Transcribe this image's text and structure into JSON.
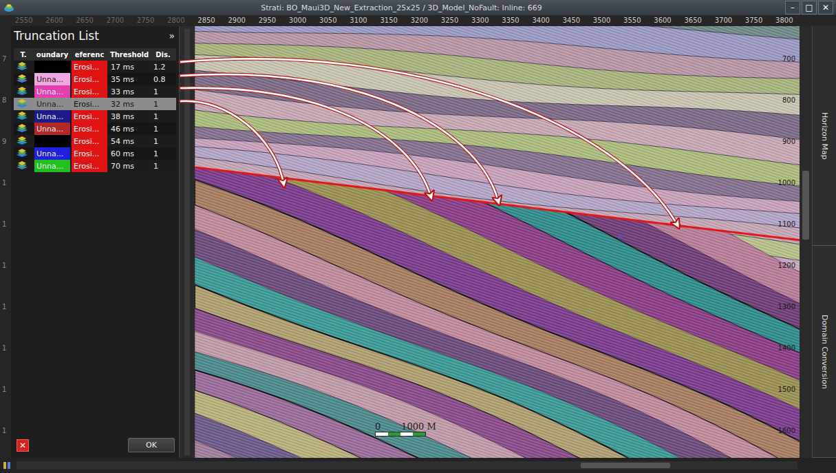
{
  "window": {
    "title": "Strati: BO_Maui3D_New_Extraction_25x25 / 3D_Model_NoFault: Inline: 669",
    "controls": [
      "–",
      "□",
      "✕"
    ]
  },
  "ruler": {
    "top": [
      "2550",
      "2600",
      "2650",
      "2700",
      "2750",
      "2800",
      "2850",
      "2900",
      "2950",
      "3000",
      "3050",
      "3100",
      "3150",
      "3200",
      "3250",
      "3300",
      "3350",
      "3400",
      "3450",
      "3500",
      "3550",
      "3600",
      "3650",
      "3700",
      "3750",
      "3800"
    ],
    "right": [
      "700",
      "800",
      "900",
      "1000",
      "1100",
      "1200",
      "1300",
      "1400",
      "1500",
      "1600"
    ],
    "left": [
      "7",
      "8",
      "9",
      "1",
      "1",
      "1",
      "1",
      "1",
      "1",
      "1"
    ]
  },
  "panel": {
    "title": "Truncation List",
    "collapse": "»",
    "columns": [
      "T.",
      "oundary",
      "eferenc",
      "Threshold",
      "Dis."
    ],
    "rows": [
      {
        "boundary": "",
        "boundary_color": "#000000",
        "reference": "Erosi...",
        "reference_color": "#e01414",
        "threshold": "17 ms",
        "dis": "1.2",
        "selected": false
      },
      {
        "boundary": "Unna...",
        "boundary_color": "#f0a8e0",
        "reference": "Erosi...",
        "reference_color": "#e01414",
        "threshold": "35 ms",
        "dis": "0.8",
        "selected": false
      },
      {
        "boundary": "Unna...",
        "boundary_color": "#e040b0",
        "reference": "Erosi...",
        "reference_color": "#e01414",
        "threshold": "33 ms",
        "dis": "1",
        "selected": false
      },
      {
        "boundary": "Unna...",
        "boundary_color": "#8c8c8c",
        "reference": "Erosi...",
        "reference_color": "#8c8c8c",
        "threshold": "32 ms",
        "dis": "1",
        "selected": true
      },
      {
        "boundary": "Unna...",
        "boundary_color": "#1c1c88",
        "reference": "Erosi...",
        "reference_color": "#e01414",
        "threshold": "38 ms",
        "dis": "1",
        "selected": false
      },
      {
        "boundary": "Unna...",
        "boundary_color": "#b02828",
        "reference": "Erosi...",
        "reference_color": "#e01414",
        "threshold": "46 ms",
        "dis": "1",
        "selected": false
      },
      {
        "boundary": "",
        "boundary_color": "#000000",
        "reference": "Erosi...",
        "reference_color": "#e01414",
        "threshold": "54 ms",
        "dis": "1",
        "selected": false
      },
      {
        "boundary": "Unna...",
        "boundary_color": "#2020e0",
        "reference": "Erosi...",
        "reference_color": "#e01414",
        "threshold": "60 ms",
        "dis": "1",
        "selected": false
      },
      {
        "boundary": "Unna...",
        "boundary_color": "#20c020",
        "reference": "Erosi...",
        "reference_color": "#e01414",
        "threshold": "70 ms",
        "dis": "1",
        "selected": false
      }
    ],
    "delete_button": "✕",
    "ok_button": "OK"
  },
  "section": {
    "scale": {
      "start": "0",
      "end": "1000 M"
    },
    "upper_layers": [
      "#6e8a86",
      "#9a9ac4",
      "#b896a6",
      "#a8b47c",
      "#c8c4b0",
      "#7c6a86",
      "#c8a8b4",
      "#acbc7c",
      "#84708e",
      "#c8a2bc",
      "#b4a6c8",
      "#c4a6b6",
      "#b8c08a",
      "#c8a8c0"
    ],
    "lower_layers": [
      "#b87c98",
      "#6e3c78",
      "#2e8c8c",
      "#8a3c86",
      "#9a9052",
      "#7a3a8c",
      "#a87c60",
      "#c08a9c",
      "#6a4a7a",
      "#3a9a96",
      "#b0a070",
      "#8a4a8a",
      "#c09aa8",
      "#4a8a8a",
      "#9a6a9a",
      "#b8b07a",
      "#6a5a8a",
      "#a07c9a"
    ],
    "erosion_color": "#e01818"
  },
  "side_tabs": [
    "Horizon Map",
    "Domain Conversion"
  ]
}
